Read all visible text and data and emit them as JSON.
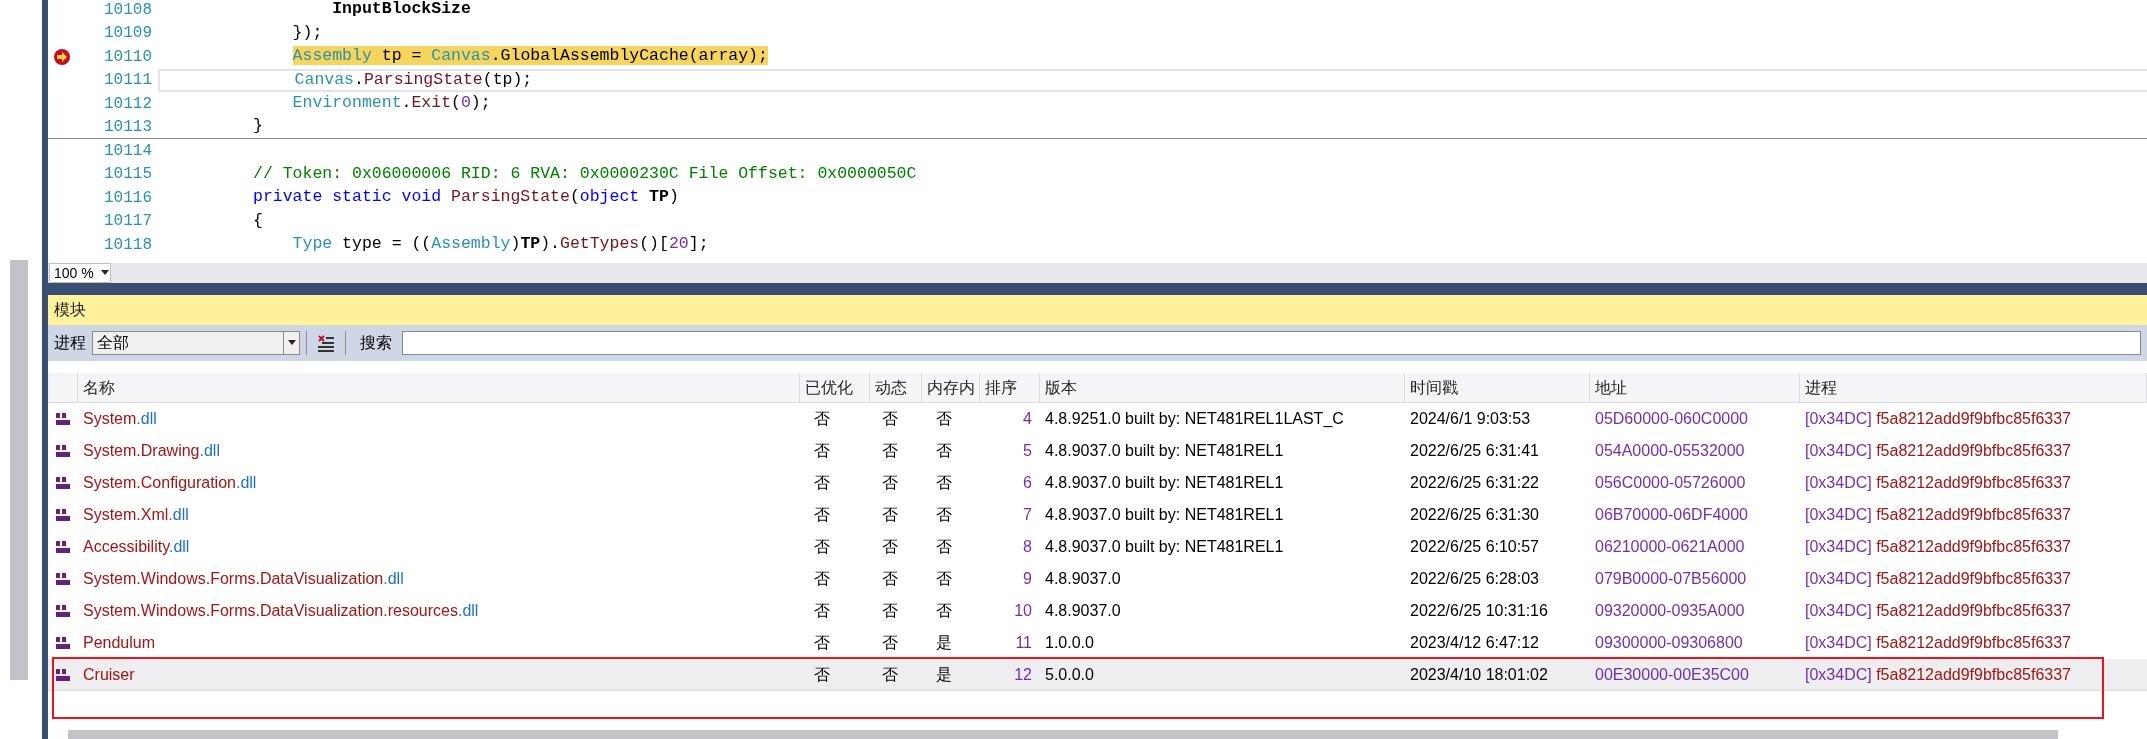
{
  "editor": {
    "lines": [
      {
        "number": "10108",
        "kind": "plain",
        "tokens": [
          {
            "kind": "bold",
            "text": "        InputBlockSize"
          }
        ]
      },
      {
        "number": "10109",
        "kind": "plain",
        "tokens": [
          {
            "kind": "plain",
            "text": "    });"
          }
        ]
      },
      {
        "number": "10110",
        "kind": "current",
        "tokens": [
          {
            "kind": "type",
            "text": "    Assembly"
          },
          {
            "kind": "plain",
            "text": " tp = "
          },
          {
            "kind": "type",
            "text": "Canvas"
          },
          {
            "kind": "plain",
            "text": ".GlobalAssemblyCache(array);"
          }
        ]
      },
      {
        "number": "10111",
        "kind": "caret",
        "tokens": [
          {
            "kind": "type",
            "text": "    Canvas"
          },
          {
            "kind": "plain",
            "text": "."
          },
          {
            "kind": "method",
            "text": "ParsingState"
          },
          {
            "kind": "plain",
            "text": "(tp);"
          }
        ]
      },
      {
        "number": "10112",
        "kind": "plain",
        "tokens": [
          {
            "kind": "type",
            "text": "    Environment"
          },
          {
            "kind": "plain",
            "text": "."
          },
          {
            "kind": "method",
            "text": "Exit"
          },
          {
            "kind": "plain",
            "text": "("
          },
          {
            "kind": "number",
            "text": "0"
          },
          {
            "kind": "plain",
            "text": ");"
          }
        ]
      },
      {
        "number": "10113",
        "kind": "end",
        "tokens": [
          {
            "kind": "plain",
            "text": "}"
          }
        ]
      },
      {
        "number": "10114",
        "kind": "plain"
      },
      {
        "number": "10115",
        "kind": "plain",
        "tokens": [
          {
            "kind": "comment",
            "text": "// Token: 0x06000006 RID: 6 RVA: 0x0000230C File Offset: 0x0000050C"
          }
        ]
      },
      {
        "number": "10116",
        "kind": "plain",
        "tokens": [
          {
            "kind": "keyword",
            "text": "private static void "
          },
          {
            "kind": "method",
            "text": "ParsingState"
          },
          {
            "kind": "plain",
            "text": "("
          },
          {
            "kind": "keyword",
            "text": "object "
          },
          {
            "kind": "bold",
            "text": "TP"
          },
          {
            "kind": "plain",
            "text": ")"
          }
        ]
      },
      {
        "number": "10117",
        "kind": "plain",
        "tokens": [
          {
            "kind": "plain",
            "text": "{"
          }
        ]
      },
      {
        "number": "10118",
        "kind": "plain",
        "tokens": [
          {
            "kind": "type",
            "text": "    Type"
          },
          {
            "kind": "plain",
            "text": " type = (("
          },
          {
            "kind": "type",
            "text": "Assembly"
          },
          {
            "kind": "plain",
            "text": ")"
          },
          {
            "kind": "bold",
            "text": "TP"
          },
          {
            "kind": "plain",
            "text": ")."
          },
          {
            "kind": "method",
            "text": "GetTypes"
          },
          {
            "kind": "plain",
            "text": "()["
          },
          {
            "kind": "number",
            "text": "20"
          },
          {
            "kind": "plain",
            "text": "];"
          }
        ]
      }
    ],
    "zoom": "100 %"
  },
  "modules": {
    "title": "模块",
    "toolbar": {
      "process_label": "进程",
      "process_value": "全部",
      "search_label": "搜索"
    },
    "columns": [
      "名称",
      "已优化",
      "动态",
      "内存内",
      "排序",
      "版本",
      "时间戳",
      "地址",
      "进程"
    ],
    "rows": [
      {
        "name": [
          {
            "kind": "base",
            "text": "System"
          },
          {
            "kind": "extension",
            "text": ".dll"
          }
        ],
        "optimized": "否",
        "dynamic": "否",
        "in_memory": "否",
        "order": "4",
        "version": "4.8.9251.0 built by: NET481REL1LAST_C",
        "timestamp": "2024/6/1 9:03:53",
        "address": "05D60000-060C0000",
        "process_id": "[0x34DC]",
        "process_name": "f5a8212add9f9bfbc85f6337",
        "selected": false
      },
      {
        "name": [
          {
            "kind": "base",
            "text": "System.Drawing"
          },
          {
            "kind": "extension",
            "text": ".dll"
          }
        ],
        "optimized": "否",
        "dynamic": "否",
        "in_memory": "否",
        "order": "5",
        "version": "4.8.9037.0 built by: NET481REL1",
        "timestamp": "2022/6/25 6:31:41",
        "address": "054A0000-05532000",
        "process_id": "[0x34DC]",
        "process_name": "f5a8212add9f9bfbc85f6337",
        "selected": false
      },
      {
        "name": [
          {
            "kind": "base",
            "text": "System.Configuration"
          },
          {
            "kind": "extension",
            "text": ".dll"
          }
        ],
        "optimized": "否",
        "dynamic": "否",
        "in_memory": "否",
        "order": "6",
        "version": "4.8.9037.0 built by: NET481REL1",
        "timestamp": "2022/6/25 6:31:22",
        "address": "056C0000-05726000",
        "process_id": "[0x34DC]",
        "process_name": "f5a8212add9f9bfbc85f6337",
        "selected": false
      },
      {
        "name": [
          {
            "kind": "base",
            "text": "System.Xml"
          },
          {
            "kind": "extension",
            "text": ".dll"
          }
        ],
        "optimized": "否",
        "dynamic": "否",
        "in_memory": "否",
        "order": "7",
        "version": "4.8.9037.0 built by: NET481REL1",
        "timestamp": "2022/6/25 6:31:30",
        "address": "06B70000-06DF4000",
        "process_id": "[0x34DC]",
        "process_name": "f5a8212add9f9bfbc85f6337",
        "selected": false
      },
      {
        "name": [
          {
            "kind": "base",
            "text": "Accessibility"
          },
          {
            "kind": "extension",
            "text": ".dll"
          }
        ],
        "optimized": "否",
        "dynamic": "否",
        "in_memory": "否",
        "order": "8",
        "version": "4.8.9037.0 built by: NET481REL1",
        "timestamp": "2022/6/25 6:10:57",
        "address": "06210000-0621A000",
        "process_id": "[0x34DC]",
        "process_name": "f5a8212add9f9bfbc85f6337",
        "selected": false
      },
      {
        "name": [
          {
            "kind": "base",
            "text": "System.Windows.Forms.DataVisualization"
          },
          {
            "kind": "extension",
            "text": ".dll"
          }
        ],
        "optimized": "否",
        "dynamic": "否",
        "in_memory": "否",
        "order": "9",
        "version": "4.8.9037.0",
        "timestamp": "2022/6/25 6:28:03",
        "address": "079B0000-07B56000",
        "process_id": "[0x34DC]",
        "process_name": "f5a8212add9f9bfbc85f6337",
        "selected": false
      },
      {
        "name": [
          {
            "kind": "base",
            "text": "System.Windows.Forms.DataVisualization.resources"
          },
          {
            "kind": "extension",
            "text": ".dll"
          }
        ],
        "optimized": "否",
        "dynamic": "否",
        "in_memory": "否",
        "order": "10",
        "version": "4.8.9037.0",
        "timestamp": "2022/6/25 10:31:16",
        "address": "09320000-0935A000",
        "process_id": "[0x34DC]",
        "process_name": "f5a8212add9f9bfbc85f6337",
        "selected": false
      },
      {
        "name": [
          {
            "kind": "base",
            "text": "Pendulum"
          }
        ],
        "optimized": "否",
        "dynamic": "否",
        "in_memory": "是",
        "order": "11",
        "version": "1.0.0.0",
        "timestamp": "2023/4/12 6:47:12",
        "address": "09300000-09306800",
        "process_id": "[0x34DC]",
        "process_name": "f5a8212add9f9bfbc85f6337",
        "selected": false
      },
      {
        "name": [
          {
            "kind": "base",
            "text": "Cruiser"
          }
        ],
        "optimized": "否",
        "dynamic": "否",
        "in_memory": "是",
        "order": "12",
        "version": "5.0.0.0",
        "timestamp": "2023/4/10 18:01:02",
        "address": "00E30000-00E35C00",
        "process_id": "[0x34DC]",
        "process_name": "f5a8212add9f9bfbc85f6337",
        "selected": true
      }
    ]
  }
}
